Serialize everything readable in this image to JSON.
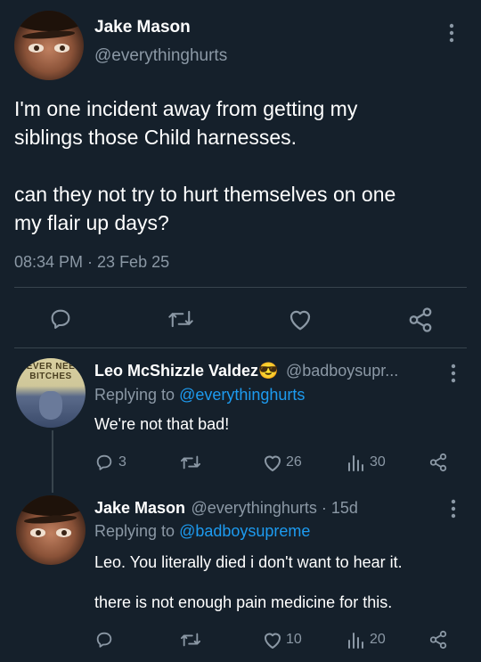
{
  "main_tweet": {
    "author_name": "Jake Mason",
    "author_handle": "@everythinghurts",
    "text_line1": "I'm one incident away from getting my",
    "text_line2": "siblings those Child harnesses.",
    "text_line3": "can they not try to hurt themselves on one",
    "text_line4": "my flair up days?",
    "timestamp": "08:34 PM · 23 Feb 25"
  },
  "reply1": {
    "author_name": "Leo McShizzle Valdez",
    "emoji": "😎",
    "author_handle": "@badboysupr...",
    "replying_label": "Replying to",
    "replying_handle": "@everythinghurts",
    "text": "We're not that bad!",
    "avatar_text_top": "NEVER NEED",
    "avatar_text_bottom": "BITCHES",
    "reply_count": "3",
    "like_count": "26",
    "view_count": "30"
  },
  "reply2": {
    "author_name": "Jake Mason",
    "author_handle_time": "@everythinghurts · 15d",
    "replying_label": "Replying to",
    "replying_handle": "@badboysupreme",
    "text_line1": "Leo. You literally died i don't want to hear it.",
    "text_line2": "there is not enough pain medicine for this.",
    "like_count": "10",
    "view_count": "20"
  },
  "colors": {
    "background": "#15202b",
    "muted": "#8b98a5",
    "link": "#1d9bf0",
    "separator": "#38444d"
  },
  "icons": [
    "more-icon",
    "reply-icon",
    "retweet-icon",
    "like-icon",
    "share-icon",
    "views-icon"
  ]
}
